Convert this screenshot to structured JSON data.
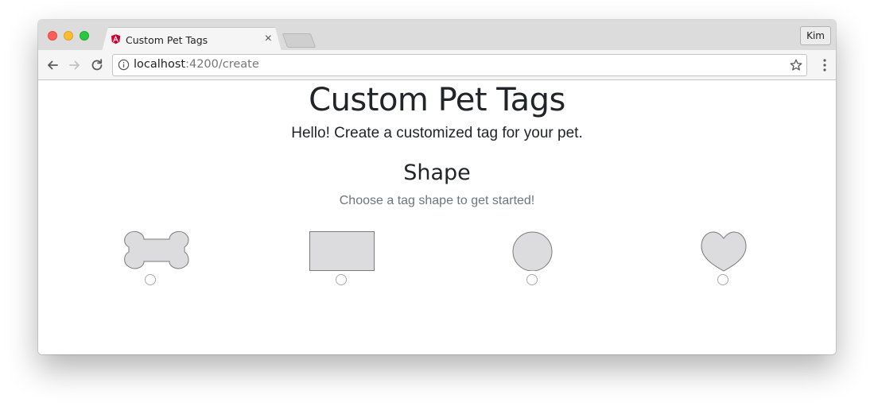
{
  "browser": {
    "tab": {
      "title": "Custom Pet Tags",
      "close_glyph": "×",
      "favicon": "angular-icon"
    },
    "profile": {
      "label": "Kim"
    },
    "address": {
      "host": "localhost",
      "path": ":4200/create"
    },
    "icons": [
      "back-arrow-icon",
      "forward-arrow-icon",
      "reload-icon",
      "info-icon",
      "star-icon",
      "menu-icon"
    ]
  },
  "page": {
    "title": "Custom Pet Tags",
    "subtitle": "Hello! Create a customized tag for your pet.",
    "section": {
      "title": "Shape",
      "hint": "Choose a tag shape to get started!"
    },
    "shapes": [
      {
        "name": "bone",
        "selected": false
      },
      {
        "name": "rectangle",
        "selected": false
      },
      {
        "name": "circle",
        "selected": false
      },
      {
        "name": "heart",
        "selected": false
      }
    ]
  },
  "colors": {
    "shape_fill": "#dcdbdd",
    "shape_stroke": "#7a7a7a",
    "angular_red": "#dd0031"
  }
}
